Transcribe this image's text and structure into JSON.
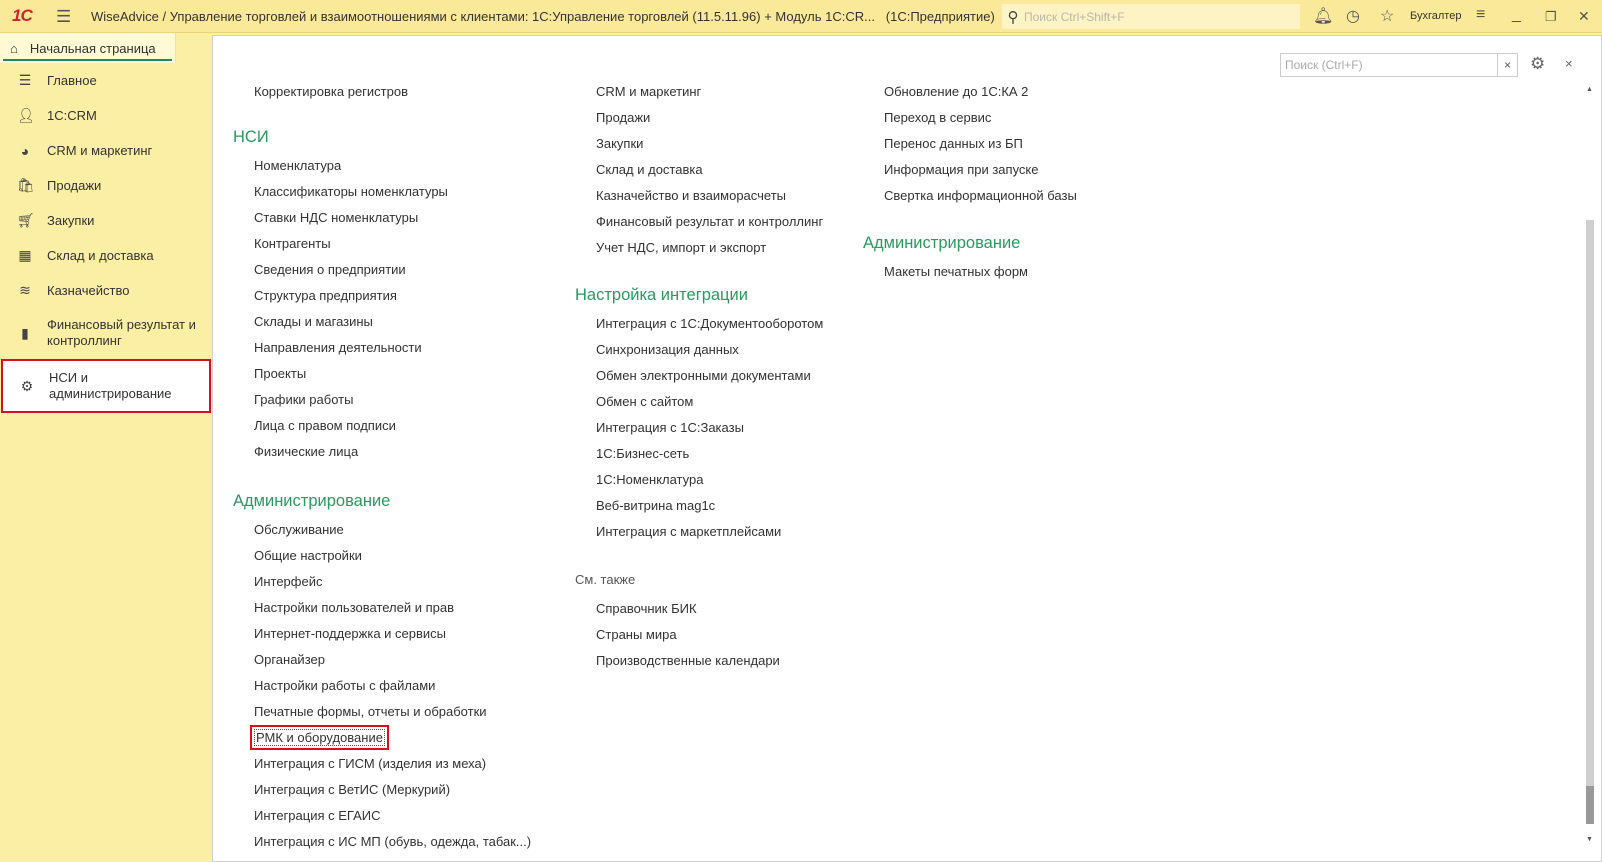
{
  "app": {
    "logo": "1С",
    "title": "WiseAdvice / Управление торговлей и взаимоотношениями с клиентами: 1С:Управление торговлей (11.5.11.96) + Модуль 1С:CR...",
    "mode": "(1С:Предприятие)",
    "search_placeholder": "Поиск Ctrl+Shift+F",
    "user": "Бухгалтер"
  },
  "tabs": {
    "home": "Начальная страница"
  },
  "sidebar": {
    "items": [
      {
        "label": "Главное",
        "icon": "menu-icon"
      },
      {
        "label": "1С:CRM",
        "icon": "crm-user-icon"
      },
      {
        "label": "CRM и маркетинг",
        "icon": "pie-chart-icon"
      },
      {
        "label": "Продажи",
        "icon": "shopping-bag-icon"
      },
      {
        "label": "Закупки",
        "icon": "cart-icon"
      },
      {
        "label": "Склад и доставка",
        "icon": "warehouse-icon"
      },
      {
        "label": "Казначейство",
        "icon": "coins-icon"
      },
      {
        "label": "Финансовый результат и контроллинг",
        "icon": "bar-chart-icon"
      },
      {
        "label": "НСИ и администрирование",
        "icon": "gear-icon",
        "selected": true
      }
    ]
  },
  "panel": {
    "search_placeholder": "Поиск (Ctrl+F)",
    "clear": "×",
    "close": "×"
  },
  "col1": {
    "top": [
      "Корректировка регистров"
    ],
    "nsi_header": "НСИ",
    "nsi": [
      "Номенклатура",
      "Классификаторы номенклатуры",
      "Ставки НДС номенклатуры",
      "Контрагенты",
      "Сведения о предприятии",
      "Структура предприятия",
      "Склады и магазины",
      "Направления деятельности",
      "Проекты",
      "Графики работы",
      "Лица с правом подписи",
      "Физические лица"
    ],
    "admin_header": "Администрирование",
    "admin": [
      "Обслуживание",
      "Общие настройки",
      "Интерфейс",
      "Настройки пользователей и прав",
      "Интернет-поддержка и сервисы",
      "Органайзер",
      "Настройки работы с файлами",
      "Печатные формы, отчеты и обработки",
      "РМК и оборудование",
      "Интеграция с ГИСМ (изделия из меха)",
      "Интеграция с ВетИС (Меркурий)",
      "Интеграция с ЕГАИС",
      "Интеграция с ИС МП (обувь, одежда, табак...)"
    ]
  },
  "col2": {
    "top": [
      "CRM и маркетинг",
      "Продажи",
      "Закупки",
      "Склад и доставка",
      "Казначейство и взаиморасчеты",
      "Финансовый результат и контроллинг",
      "Учет НДС, импорт и экспорт"
    ],
    "integ_header": "Настройка интеграции",
    "integ": [
      "Интеграция с 1С:Документооборотом",
      "Синхронизация данных",
      "Обмен электронными документами",
      "Обмен с сайтом",
      "Интеграция с 1С:Заказы",
      "1С:Бизнес-сеть",
      "1С:Номенклатура",
      "Веб-витрина mag1c",
      "Интеграция с маркетплейсами"
    ],
    "see_header": "См. также",
    "see": [
      "Справочник БИК",
      "Страны мира",
      "Производственные календари"
    ]
  },
  "col3": {
    "top": [
      "Обновление до 1С:КА 2",
      "Переход в сервис",
      "Перенос данных из БП",
      "Информация при запуске",
      "Свертка информационной базы"
    ],
    "admin_header": "Администрирование",
    "admin": [
      "Макеты печатных форм"
    ]
  }
}
